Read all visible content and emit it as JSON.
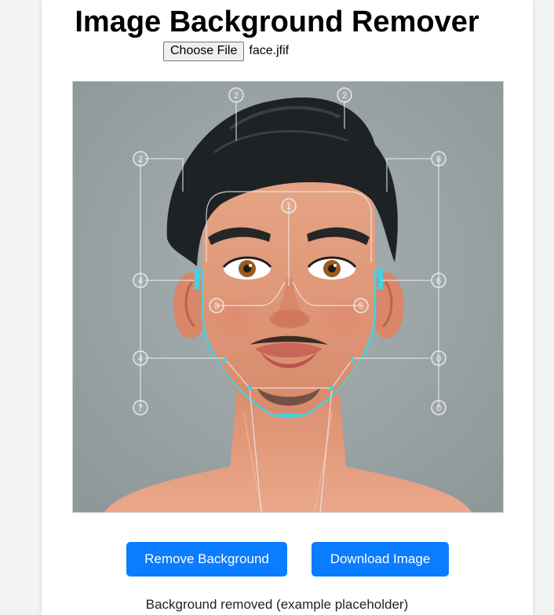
{
  "page": {
    "title": "Image Background Remover"
  },
  "file_input": {
    "button_label": "Choose File",
    "file_name": "face.jfif"
  },
  "preview_image": {
    "description_icon": "face-landmark-illustration",
    "labels": [
      "1",
      "2",
      "2",
      "2",
      "3",
      "4",
      "4",
      "5",
      "6",
      "6",
      "7",
      "8",
      "0",
      "0"
    ]
  },
  "actions": {
    "remove_label": "Remove Background",
    "download_label": "Download Image"
  },
  "status": {
    "text": "Background removed (example placeholder)"
  },
  "colors": {
    "accent": "#0a7cff",
    "background": "#f3f3f3",
    "panel": "#ffffff",
    "image_bg": "#9aa3a5",
    "landmark_line": "#e8ecec",
    "landmark_glow": "#3fd3e6"
  }
}
